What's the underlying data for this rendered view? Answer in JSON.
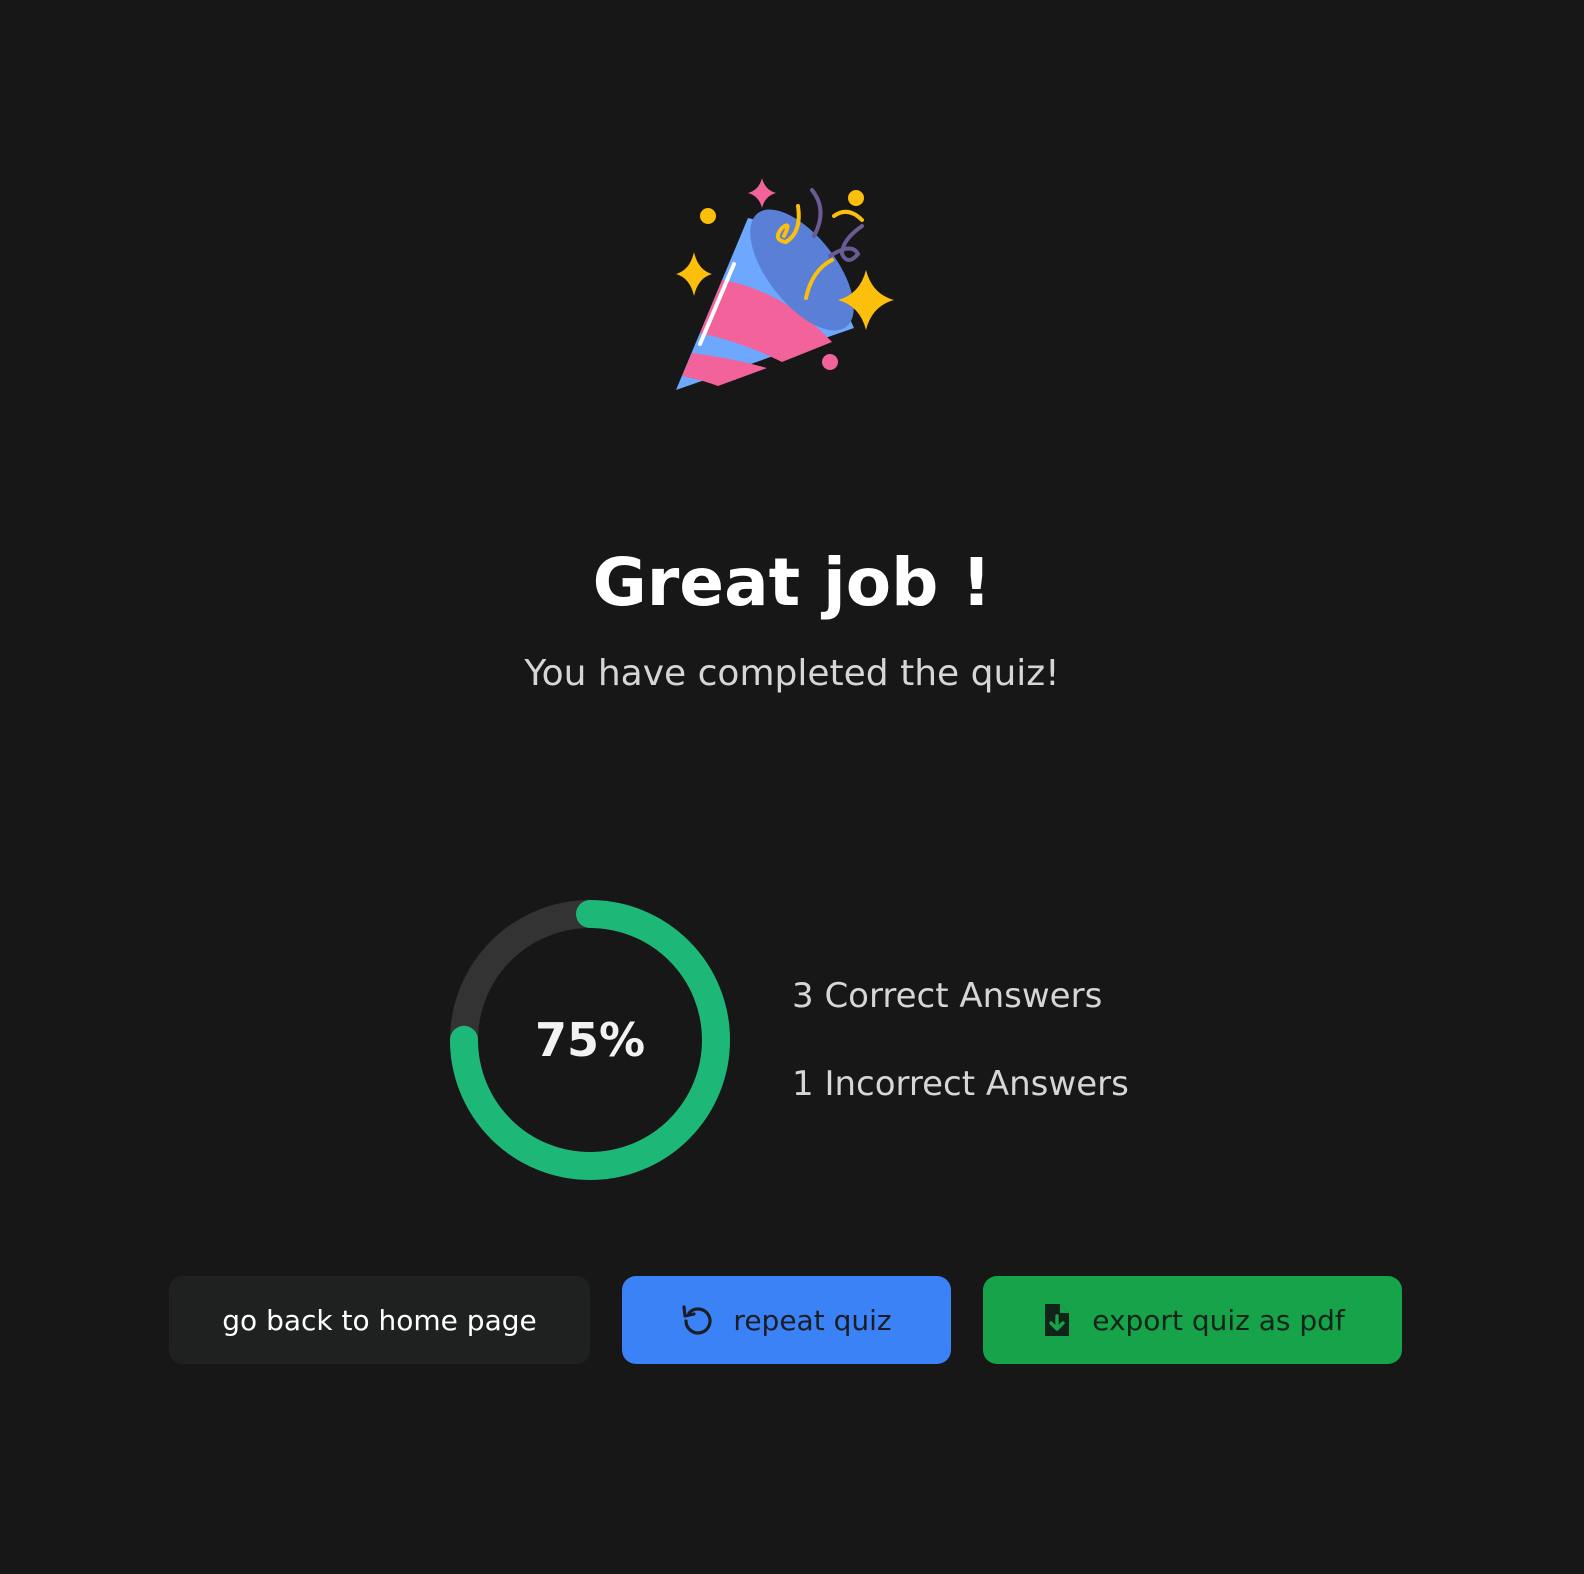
{
  "header": {
    "icon": "party-popper-icon",
    "title": "Great job !",
    "subtitle": "You have completed the quiz!"
  },
  "result": {
    "score_label": "75%",
    "score_fraction": 0.75,
    "correct_text": "3 Correct Answers",
    "incorrect_text": "1 Incorrect Answers",
    "ring_color": "#1db877",
    "ring_track_color": "#333333"
  },
  "actions": {
    "home_label": "go back to home page",
    "repeat_label": "repeat quiz",
    "repeat_icon": "refresh-icon",
    "export_label": "export quiz as pdf",
    "export_icon": "file-download-icon"
  },
  "colors": {
    "background": "#171717",
    "repeat_button": "#3b82f6",
    "export_button": "#16a34a"
  }
}
